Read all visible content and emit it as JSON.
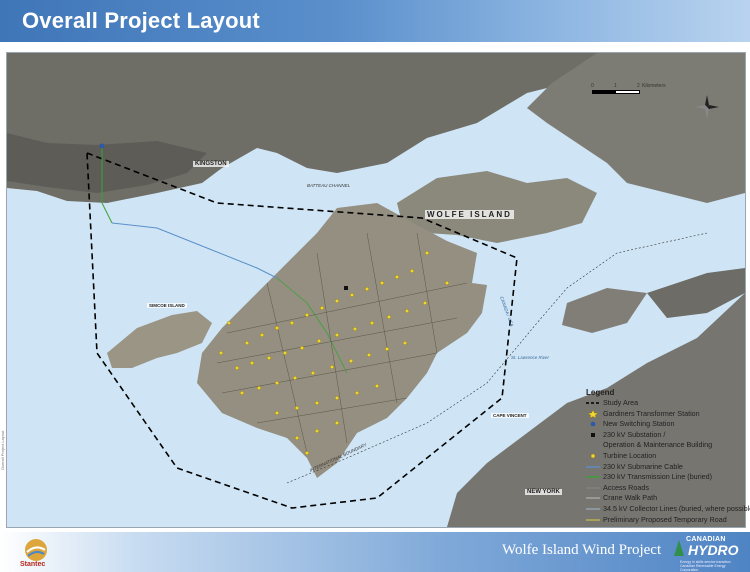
{
  "header": {
    "title": "Overall Project Layout"
  },
  "map": {
    "place_labels": {
      "kingston": "KINGSTON",
      "wolfe_island": "WOLFE ISLAND",
      "new_york": "NEW YORK",
      "simcoe_island": "SIMCOE ISLAND",
      "cape_vincent": "CAPE VINCENT"
    },
    "water_labels": {
      "st_lawrence": "St. Lawrence River",
      "canada_usa": "CANADA / USA",
      "international_boundary": "INTERNATIONAL BOUNDARY",
      "batteau": "BATTEAU CHANNEL"
    },
    "scale": {
      "ticks": [
        "0",
        "1",
        "2"
      ],
      "unit": "Kilometers"
    },
    "colors": {
      "water": "#cfe5f5",
      "island": "#8e8a7c",
      "turbine": "#f1d531",
      "study_area": "#000000",
      "submarine_cable": "#5b8fc9",
      "transmission": "#3aa335"
    }
  },
  "legend": {
    "title": "Legend",
    "items": [
      {
        "label": "Study Area",
        "icon": "dashed-line"
      },
      {
        "label": "Gardiners Transformer Station",
        "icon": "yellow-star"
      },
      {
        "label": "New Switching Station",
        "icon": "blue-dot"
      },
      {
        "label": "230 kV Substation /",
        "icon": "black-square"
      },
      {
        "label": "Operation & Maintenance Building",
        "icon": "none"
      },
      {
        "label": "Turbine Location",
        "icon": "yellow-dot"
      },
      {
        "label": "230 kV Submarine Cable",
        "icon": "blue-line"
      },
      {
        "label": "230 kV Transmission Line (buried)",
        "icon": "green-line"
      },
      {
        "label": "Access Roads",
        "icon": "gray-line"
      },
      {
        "label": "Crane Walk Path",
        "icon": "light-line"
      },
      {
        "label": "34.5 kV Collector Lines (buried, where possible)",
        "icon": "thin-line"
      },
      {
        "label": "Preliminary Proposed Temporary Road",
        "icon": "olive-line"
      }
    ]
  },
  "footer": {
    "project_name": "Wolfe Island Wind Project",
    "stantec": "Stantec",
    "canadian": "CANADIAN",
    "hydro": "HYDRO",
    "hydro_tagline": "Energy in skills service transition Canadian Renewable Energy Corporation",
    "side_note": "Overall Project Layout"
  }
}
